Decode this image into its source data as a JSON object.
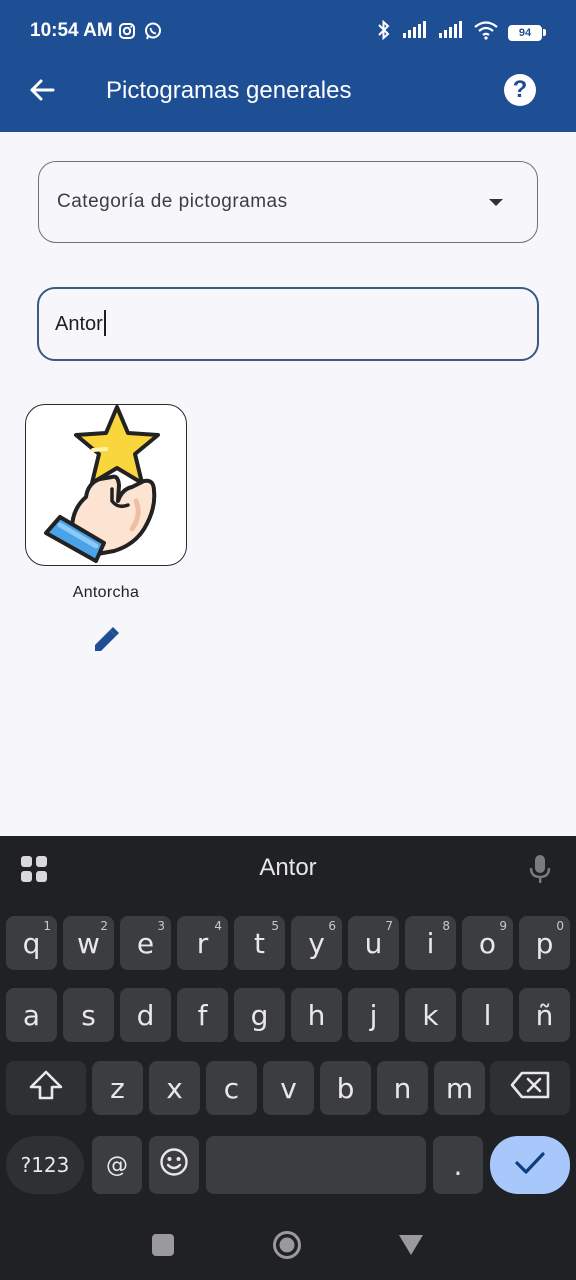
{
  "status_bar": {
    "time": "10:54 AM",
    "left_icons": [
      "instagram-icon",
      "whatsapp-icon"
    ],
    "right_icons": [
      "bluetooth-icon",
      "signal-icon",
      "signal-icon",
      "wifi-icon"
    ],
    "battery": "94"
  },
  "app_bar": {
    "title": "Pictogramas generales",
    "back_icon": "arrow-back-icon",
    "help_icon": "help-icon",
    "help_glyph": "?"
  },
  "category_dropdown": {
    "placeholder": "Categoría de pictogramas"
  },
  "search": {
    "value": "Antor"
  },
  "results": [
    {
      "label": "Antorcha",
      "image": "hand-holding-star",
      "edit_icon": "pencil-icon"
    }
  ],
  "keyboard": {
    "suggestion": "Antor",
    "row1": [
      {
        "k": "q",
        "h": "1"
      },
      {
        "k": "w",
        "h": "2"
      },
      {
        "k": "e",
        "h": "3"
      },
      {
        "k": "r",
        "h": "4"
      },
      {
        "k": "t",
        "h": "5"
      },
      {
        "k": "y",
        "h": "6"
      },
      {
        "k": "u",
        "h": "7"
      },
      {
        "k": "i",
        "h": "8"
      },
      {
        "k": "o",
        "h": "9"
      },
      {
        "k": "p",
        "h": "0"
      }
    ],
    "row2": [
      "a",
      "s",
      "d",
      "f",
      "g",
      "h",
      "j",
      "k",
      "l",
      "ñ"
    ],
    "row3": [
      "z",
      "x",
      "c",
      "v",
      "b",
      "n",
      "m"
    ],
    "symbols_key": "?123",
    "at_key": "@",
    "period_key": ".",
    "colors": {
      "enter_key": "#a8c7fa",
      "key": "#3c3d41"
    }
  },
  "colors": {
    "primary": "#1e4f95",
    "background": "#f7f6fb"
  }
}
